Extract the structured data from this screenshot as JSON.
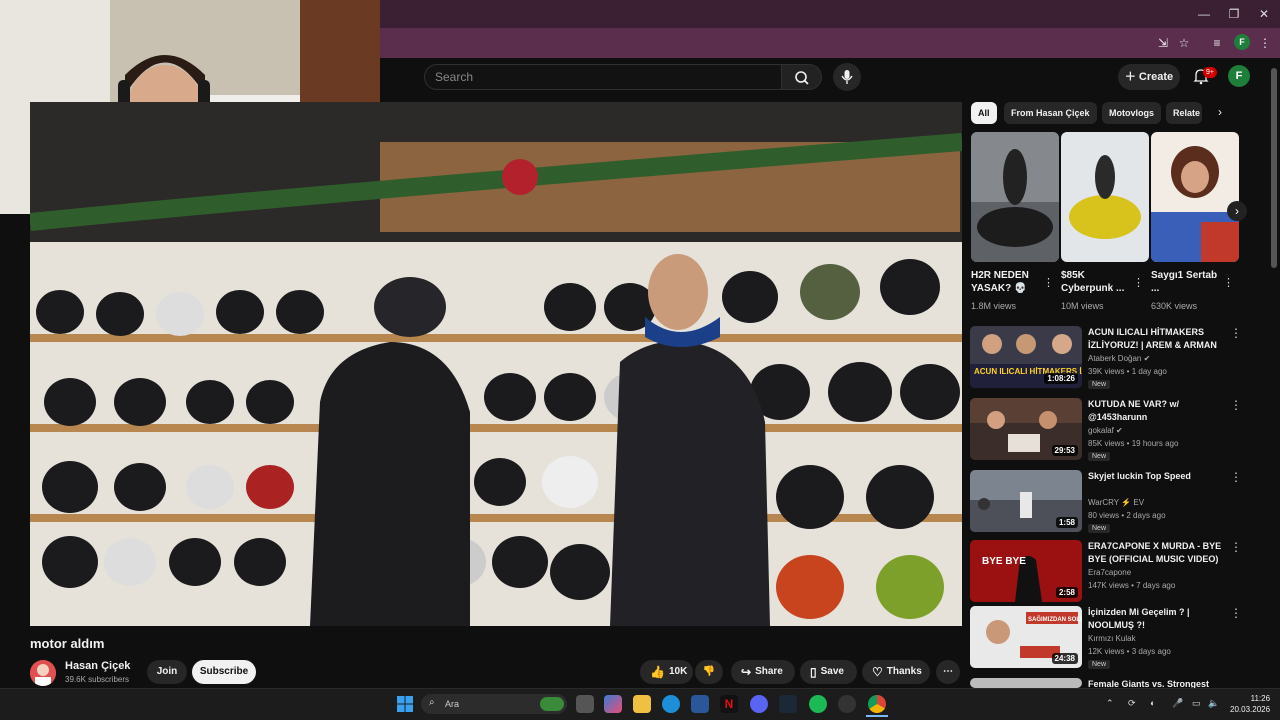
{
  "browser": {
    "window_controls": [
      "—",
      "❐",
      "✕"
    ],
    "profile_letter": "F"
  },
  "header": {
    "search_placeholder": "Search",
    "create_label": "Create",
    "notifications_badge": "9+",
    "avatar_letter": "F"
  },
  "video": {
    "title": "motor aldım",
    "channel": "Hasan Çiçek",
    "subscribers": "39.6K subscribers",
    "join_label": "Join",
    "subscribe_label": "Subscribe",
    "likes": "10K",
    "share_label": "Share",
    "save_label": "Save",
    "thanks_label": "Thanks"
  },
  "sidebar": {
    "chips": [
      "All",
      "From Hasan Çiçek",
      "Motovlogs",
      "Relate"
    ],
    "shorts": [
      {
        "title": "H2R NEDEN YASAK? 💀",
        "views": "1.8M views"
      },
      {
        "title": "$85K Cyberpunk ...",
        "views": "10M views"
      },
      {
        "title": "Saygı1 Sertab ...",
        "views": "630K views"
      }
    ],
    "recommendations": [
      {
        "title": "ACUN ILICALI HİTMAKERS İZLİYORUZ! | AREM & ARMAN",
        "channel": "Ataberk Doğan ✔",
        "meta": "39K views • 1 day ago",
        "badge": "New",
        "duration": "1:08:26",
        "thumb_text": "ACUN ILICALI HİTMAKERS İZLİY"
      },
      {
        "title": "KUTUDA NE VAR? w/ @1453harunn",
        "channel": "gokalaf ✔",
        "meta": "85K views • 19 hours ago",
        "badge": "New",
        "duration": "29:53",
        "thumb_text": ""
      },
      {
        "title": "Skyjet luckin Top Speed",
        "channel": "WarCRY ⚡ EV",
        "meta": "80 views • 2 days ago",
        "badge": "New",
        "duration": "1:58",
        "thumb_text": ""
      },
      {
        "title": "ERA7CAPONE X MURDA - BYE BYE (OFFICIAL MUSIC VIDEO)",
        "channel": "Era7capone",
        "meta": "147K views • 7 days ago",
        "badge": "",
        "duration": "2:58",
        "thumb_text": "BYE BYE"
      },
      {
        "title": "İçinizden Mi Geçelim ? | NOOLMUŞ ?!",
        "channel": "Kırmızı Kulak",
        "meta": "12K views • 3 days ago",
        "badge": "New",
        "duration": "24:38",
        "thumb_text": "SAĞIMIZDAN SOLUMUZDAN"
      },
      {
        "title": "Female Giants vs. Strongest",
        "channel": "",
        "meta": "",
        "badge": "",
        "duration": "",
        "thumb_text": ""
      }
    ]
  },
  "taskbar": {
    "search_label": "Ara",
    "time": "11:26",
    "date": "20.03.2026"
  },
  "colors": {
    "browser_frame": "#3b1f33",
    "yt_background": "#0f0f0f",
    "chip_bg": "#272727",
    "subscribe_bg": "#f1f1f1",
    "brand_red": "#cc0000"
  }
}
